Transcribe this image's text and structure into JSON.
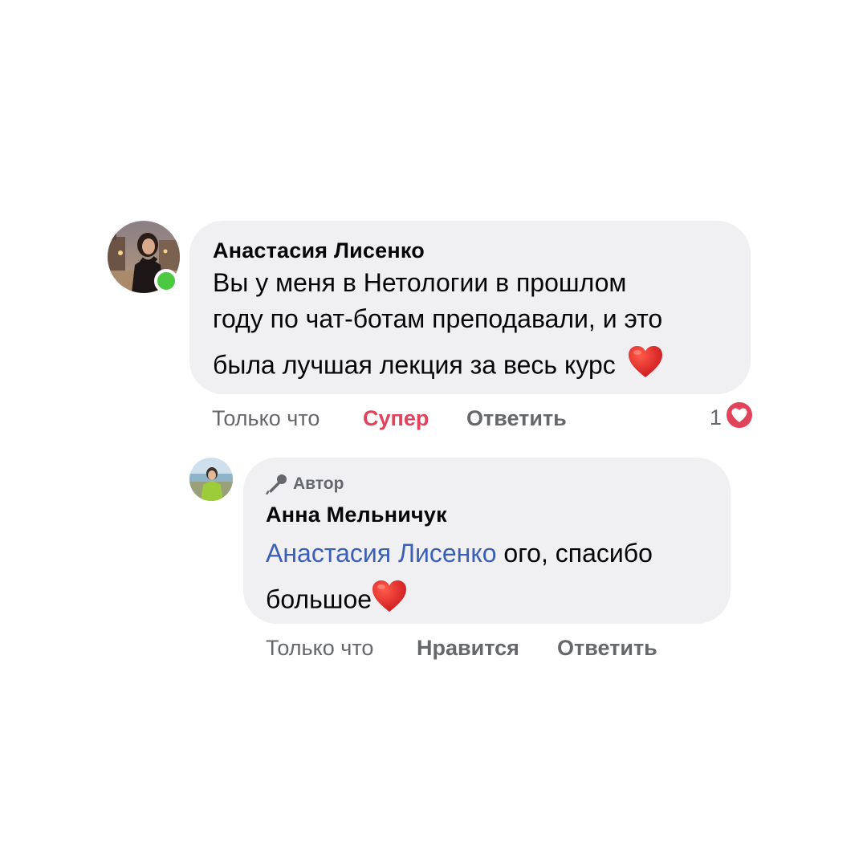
{
  "comments": [
    {
      "author": "Анастасия Лисенко",
      "lines": [
        "Вы у меня в Нетологии в прошлом",
        "году по чат-ботам преподавали, и это",
        "была лучшая лекция за весь курс"
      ],
      "emoji": "heart-emoji",
      "online": true,
      "actions": {
        "time": "Только что",
        "reaction_label": "Супер",
        "reply_label": "Ответить"
      },
      "reaction_count": "1",
      "reaction_icon": "heart-reaction-icon"
    },
    {
      "badge_label": "Автор",
      "author": "Анна Мельничук",
      "mention": "Анастасия Лисенко",
      "text_after_mention": " ого, спасибо",
      "line2": "большое",
      "emoji": "heart-emoji",
      "actions": {
        "time": "Только что",
        "like_label": "Нравится",
        "reply_label": "Ответить"
      }
    }
  ],
  "colors": {
    "bubble": "#f0f0f3",
    "mention": "#3a5fb6",
    "reaction_active": "#e0435a",
    "muted": "#65676b",
    "online": "#4bc940"
  }
}
